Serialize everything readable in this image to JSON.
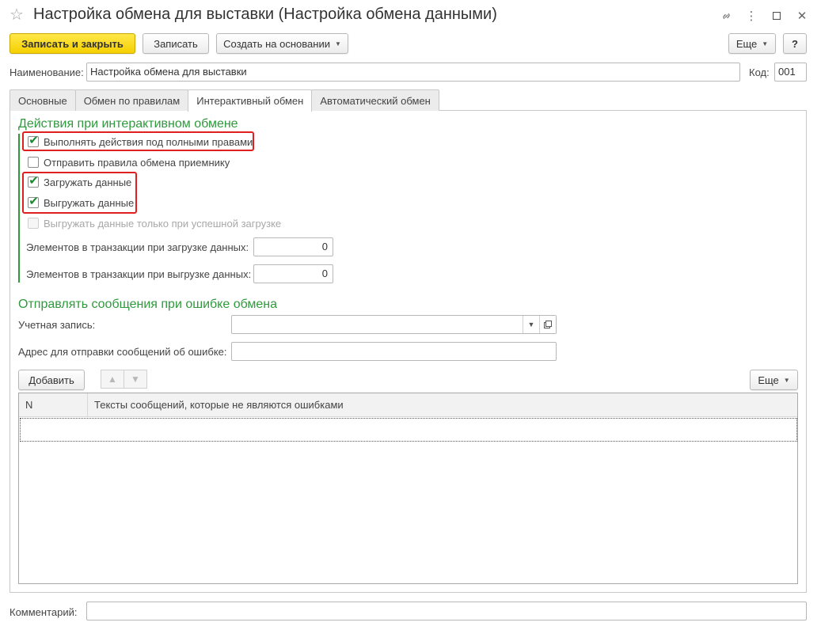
{
  "window": {
    "title": "Настройка обмена для выставки (Настройка обмена данными)"
  },
  "toolbar": {
    "save_close": "Записать и закрыть",
    "save": "Записать",
    "create_based": "Создать на основании",
    "more": "Еще",
    "help": "?"
  },
  "header": {
    "name_label": "Наименование:",
    "name_value": "Настройка обмена для выставки",
    "code_label": "Код:",
    "code_value": "001"
  },
  "tabs": [
    {
      "label": "Основные",
      "active": false
    },
    {
      "label": "Обмен по правилам",
      "active": false
    },
    {
      "label": "Интерактивный обмен",
      "active": true
    },
    {
      "label": "Автоматический обмен",
      "active": false
    }
  ],
  "interactive": {
    "section_title": "Действия при интерактивном обмене",
    "options": [
      {
        "label": "Выполнять действия под полными правами",
        "checked": true,
        "disabled": false
      },
      {
        "label": "Отправить правила обмена приемнику",
        "checked": false,
        "disabled": false
      },
      {
        "label": "Загружать данные",
        "checked": true,
        "disabled": false
      },
      {
        "label": "Выгружать данные",
        "checked": true,
        "disabled": false
      },
      {
        "label": "Выгружать данные только при успешной загрузке",
        "checked": false,
        "disabled": true
      }
    ],
    "import_tx_label": "Элементов в транзакции при загрузке данных:",
    "import_tx_value": "0",
    "export_tx_label": "Элементов в транзакции при выгрузке данных:",
    "export_tx_value": "0"
  },
  "errors": {
    "section_title": "Отправлять сообщения при ошибке обмена",
    "account_label": "Учетная запись:",
    "account_value": "",
    "address_label": "Адрес для отправки сообщений об ошибке:",
    "address_value": "",
    "add_button": "Добавить",
    "more_button": "Еще",
    "table": {
      "columns": [
        "N",
        "Тексты сообщений, которые не являются ошибками"
      ],
      "rows": []
    }
  },
  "footer": {
    "comment_label": "Комментарий:",
    "comment_value": ""
  },
  "colors": {
    "accent_green": "#2e9a3c",
    "primary_yellow": "#f5d000",
    "highlight_red": "#e02020"
  }
}
